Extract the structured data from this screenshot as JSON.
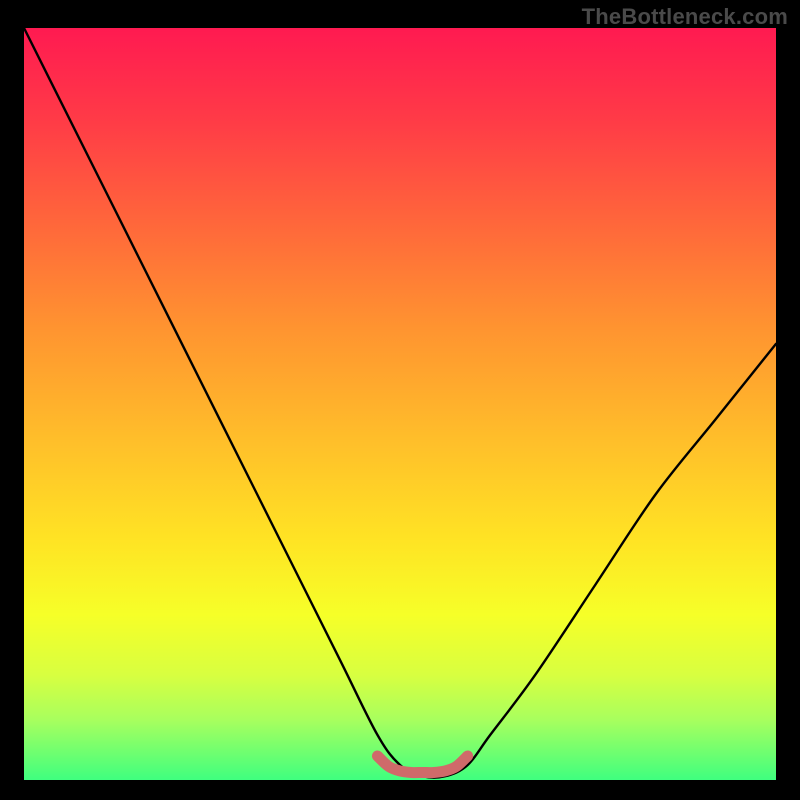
{
  "watermark": "TheBottleneck.com",
  "colors": {
    "frame": "#000000",
    "curve_stroke": "#000000",
    "bottom_marker": "#cf6a6a",
    "gradient_top": "#ff1a51",
    "gradient_bottom": "#3fff7f"
  },
  "chart_data": {
    "type": "line",
    "title": "",
    "xlabel": "",
    "ylabel": "",
    "xlim": [
      0,
      100
    ],
    "ylim": [
      0,
      100
    ],
    "grid": false,
    "series": [
      {
        "name": "bottleneck-curve",
        "x": [
          0,
          4,
          10,
          18,
          26,
          34,
          42,
          47,
          50,
          53,
          56,
          59,
          62,
          68,
          76,
          84,
          92,
          100
        ],
        "y": [
          100,
          92,
          80,
          64,
          48,
          32,
          16,
          6,
          2,
          0.5,
          0.5,
          2,
          6,
          14,
          26,
          38,
          48,
          58
        ]
      },
      {
        "name": "sweet-spot-marker",
        "x": [
          47,
          48.5,
          50,
          51.5,
          53,
          54.5,
          56,
          57.5,
          59
        ],
        "y": [
          3.2,
          1.8,
          1.2,
          1.0,
          1.0,
          1.0,
          1.2,
          1.8,
          3.2
        ]
      }
    ]
  }
}
